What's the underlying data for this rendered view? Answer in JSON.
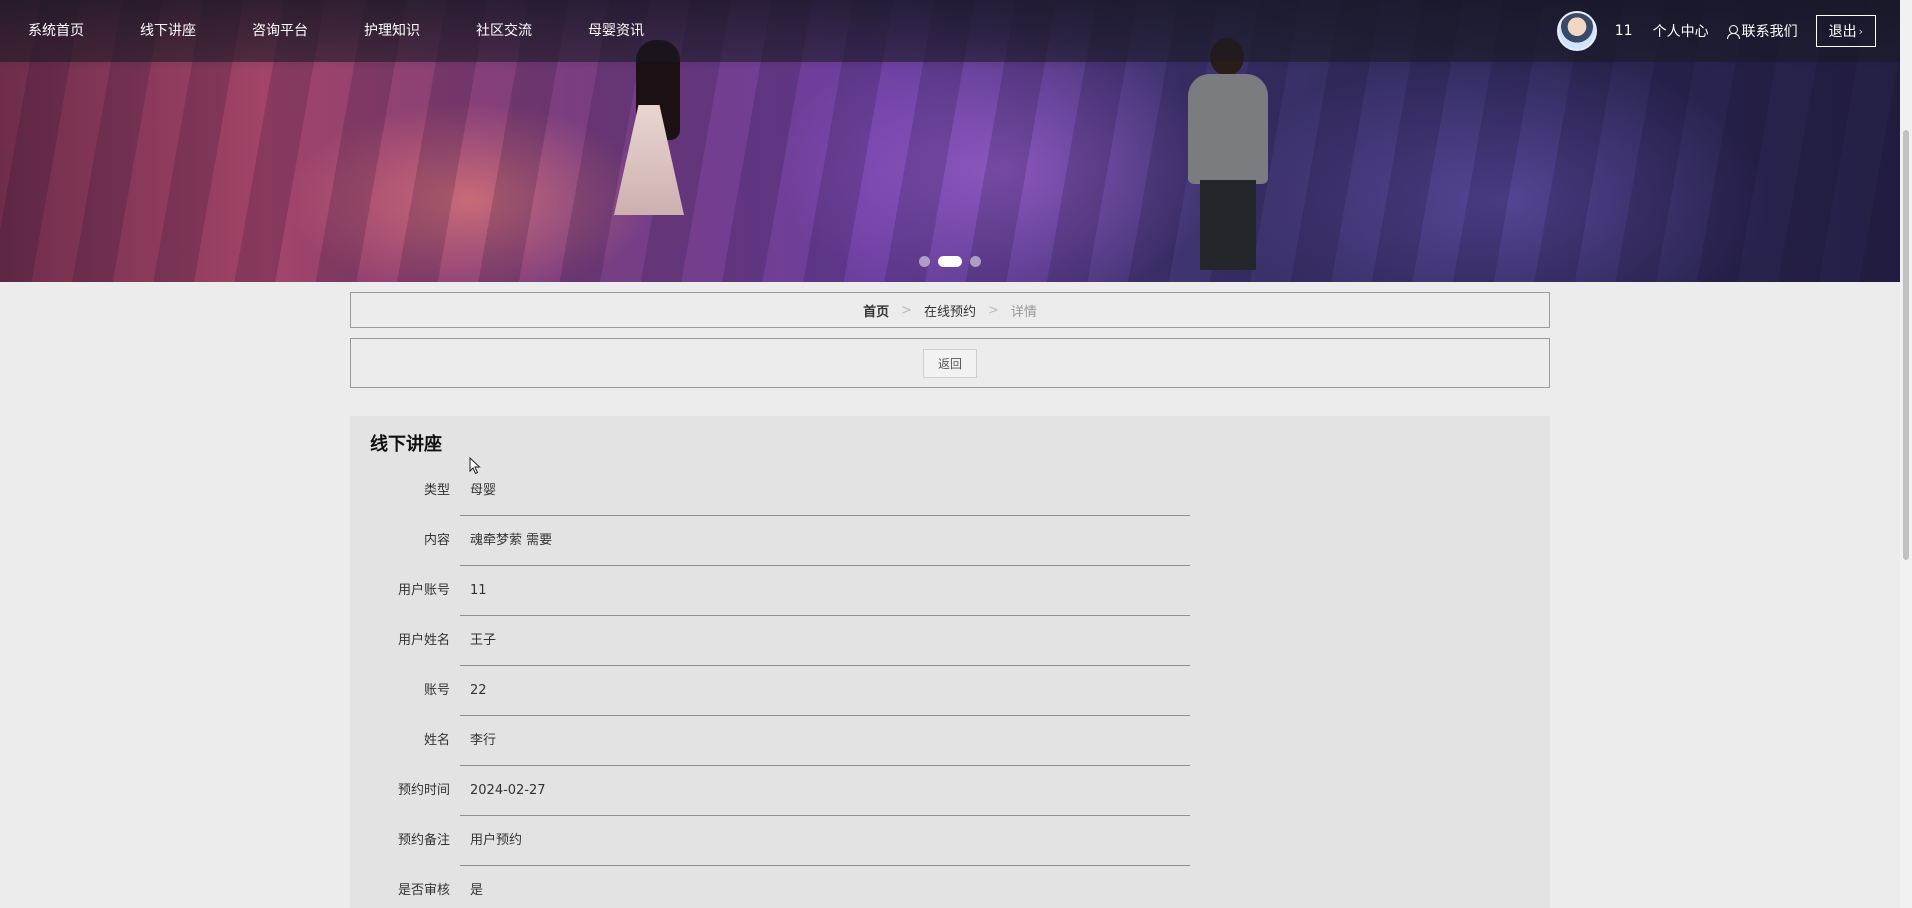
{
  "nav": {
    "items": [
      "系统首页",
      "线下讲座",
      "咨询平台",
      "护理知识",
      "社区交流",
      "母婴资讯"
    ],
    "username": "11",
    "profile_label": "个人中心",
    "contact_label": "联系我们",
    "logout_label": "退出",
    "logout_arrow": "›"
  },
  "banner": {
    "slide_count": 3,
    "active_slide": 2
  },
  "breadcrumb": {
    "home": "首页",
    "section": "在线预约",
    "current": "详情",
    "separator": ">"
  },
  "actions": {
    "back_label": "返回"
  },
  "detail": {
    "title": "线下讲座",
    "fields": [
      {
        "label": "类型",
        "value": "母婴"
      },
      {
        "label": "内容",
        "value": "魂牵梦萦 需要"
      },
      {
        "label": "用户账号",
        "value": "11"
      },
      {
        "label": "用户姓名",
        "value": "王子"
      },
      {
        "label": "账号",
        "value": "22"
      },
      {
        "label": "姓名",
        "value": "李行"
      },
      {
        "label": "预约时间",
        "value": "2024-02-27"
      },
      {
        "label": "预约备注",
        "value": "用户预约"
      },
      {
        "label": "是否审核",
        "value": "是"
      }
    ]
  }
}
